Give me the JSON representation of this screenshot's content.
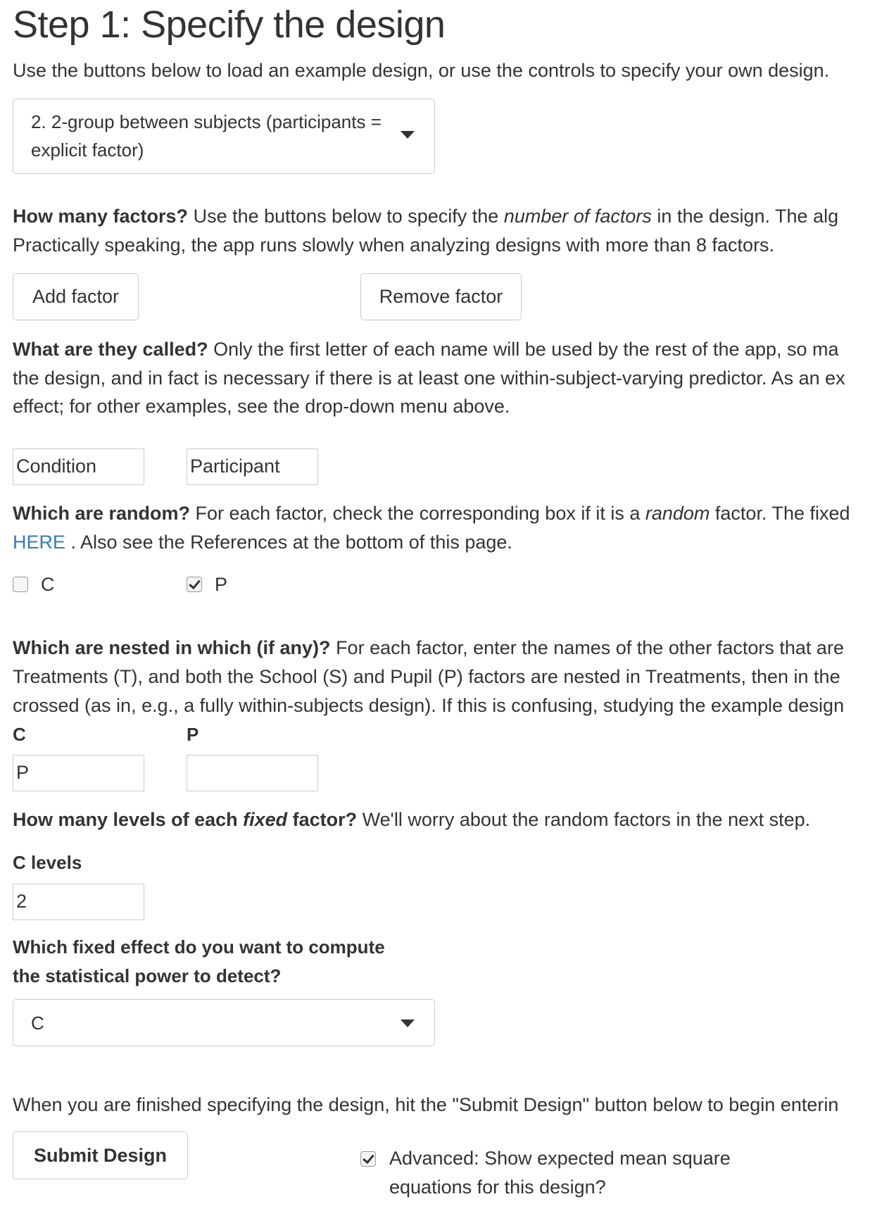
{
  "page": {
    "title": "Step 1: Specify the design",
    "intro": "Use the buttons below to load an example design, or use the controls to specify your own design."
  },
  "example_select": {
    "line1": "2. 2-group between subjects (participants =",
    "line2": "explicit factor)"
  },
  "factors": {
    "heading": "How many factors?",
    "text_a": " Use the buttons below to specify the ",
    "text_em": "number of factors",
    "text_b": " in the design. The alg",
    "line2": "Practically speaking, the app runs slowly when analyzing designs with more than 8 factors.",
    "add_label": "Add factor",
    "remove_label": "Remove factor"
  },
  "names": {
    "heading": "What are they called?",
    "text1": " Only the first letter of each name will be used by the rest of the app, so ma",
    "line2": "the design, and in fact is necessary if there is at least one within-subject-varying predictor. As an ex",
    "line3": "effect; for other examples, see the drop-down menu above.",
    "values": [
      "Condition",
      "Participant"
    ]
  },
  "random": {
    "heading": "Which are random?",
    "text_a": " For each factor, check the corresponding box if it is a ",
    "text_em": "random",
    "text_b": " factor. The fixed",
    "link": "HERE",
    "text_after_link": " . Also see the References at the bottom of this page.",
    "items": [
      {
        "label": "C",
        "checked": false
      },
      {
        "label": "P",
        "checked": true
      }
    ]
  },
  "nested": {
    "heading": "Which are nested in which (if any)?",
    "text1": " For each factor, enter the names of the other factors that are",
    "line2": "Treatments (T), and both the School (S) and Pupil (P) factors are nested in Treatments, then in the",
    "line3": "crossed (as in, e.g., a fully within-subjects design). If this is confusing, studying the example design",
    "labels": [
      "C",
      "P"
    ],
    "values": [
      "P",
      ""
    ]
  },
  "levels": {
    "heading_a": "How many levels of each ",
    "heading_em": "fixed",
    "heading_b": " factor?",
    "text": " We'll worry about the random factors in the next step.",
    "label": "C levels",
    "value": "2"
  },
  "power": {
    "line1": "Which fixed effect do you want to compute",
    "line2": "the statistical power to detect?",
    "selected": "C"
  },
  "submit": {
    "text": "When you are finished specifying the design, hit the \"Submit Design\" button below to begin enterin",
    "button_label": "Submit Design",
    "advanced_line1": "Advanced: Show expected mean square",
    "advanced_line2": "equations for this design?",
    "advanced_checked": true
  }
}
